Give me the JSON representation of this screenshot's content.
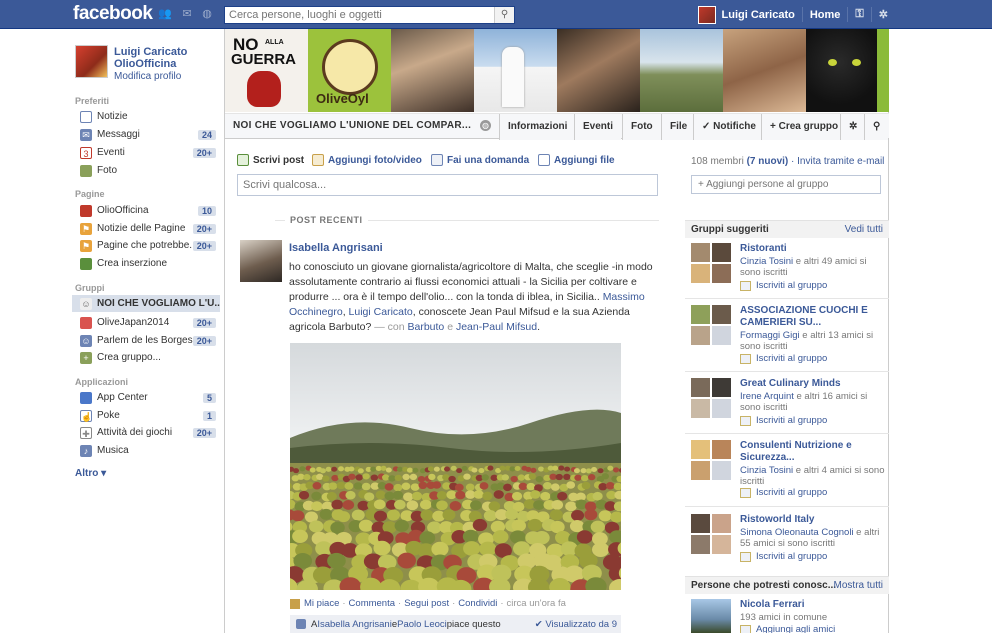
{
  "topbar": {
    "logo": "facebook",
    "search_placeholder": "Cerca persone, luoghi e oggetti",
    "user_name": "Luigi Caricato",
    "home_label": "Home"
  },
  "profile": {
    "name_line1": "Luigi Caricato",
    "name_line2": "OlioOfficina",
    "edit": "Modifica profilo"
  },
  "sidebar": {
    "favorites_heading": "Preferiti",
    "favorites": [
      {
        "label": "Notizie",
        "count": ""
      },
      {
        "label": "Messaggi",
        "count": "24"
      },
      {
        "label": "Eventi",
        "count": "20+"
      },
      {
        "label": "Foto",
        "count": ""
      }
    ],
    "pages_heading": "Pagine",
    "pages": [
      {
        "label": "OlioOfficina",
        "count": "10"
      },
      {
        "label": "Notizie delle Pagine",
        "count": "20+"
      },
      {
        "label": "Pagine che potrebbe...",
        "count": "20+"
      },
      {
        "label": "Crea inserzione",
        "count": ""
      }
    ],
    "groups_heading": "Gruppi",
    "groups": [
      {
        "label": "NOI CHE VOGLIAMO L'U...",
        "count": ""
      },
      {
        "label": "OliveJapan2014",
        "count": "20+"
      },
      {
        "label": "Parlem de les Borges...",
        "count": "20+"
      },
      {
        "label": "Crea gruppo...",
        "count": ""
      }
    ],
    "apps_heading": "Applicazioni",
    "apps": [
      {
        "label": "App Center",
        "count": "5"
      },
      {
        "label": "Poke",
        "count": "1"
      },
      {
        "label": "Attività dei giochi",
        "count": "20+"
      },
      {
        "label": "Musica",
        "count": ""
      }
    ],
    "more": "Altro ▾"
  },
  "cover": {
    "tile1_text_a": "NO",
    "tile1_text_b": "ALLA",
    "tile1_text_c": "GUERRA",
    "tile2_text": "OliveOyl"
  },
  "group": {
    "title": "NOI CHE VOGLIAMO L'UNIONE DEL COMPAR...",
    "tabs": [
      "Informazioni",
      "Eventi",
      "Foto",
      "File"
    ],
    "notifications": "✓ Notifiche",
    "create_group": "+ Crea gruppo"
  },
  "composer": {
    "options": [
      "Scrivi post",
      "Aggiungi foto/video",
      "Fai una domanda",
      "Aggiungi file"
    ],
    "placeholder": "Scrivi qualcosa..."
  },
  "recent_label": "POST RECENTI",
  "post": {
    "author": "Isabella Angrisani",
    "text_a": "ho conosciuto un giovane giornalista/agricoltore di Malta, che sceglie -in modo assolutamente contrario ai flussi economici attuali - la Sicilia per coltivare e produrre ... ora è il tempo dell'olio... con la tonda di iblea, in Sicilia.. ",
    "tag1": "Massimo Occhinegro",
    "tag2": "Luigi Caricato",
    "text_b": ", conoscete Jean Paul Mifsud e la sua Azienda agricola Barbuto?",
    "with_prefix": " — con ",
    "with1": "Barbuto",
    "with_and": " e ",
    "with2": "Jean-Paul Mifsud",
    "text_end": ".",
    "actions": [
      "Mi piace",
      "Commenta",
      "Segui post",
      "Condividi"
    ],
    "time": "circa un'ora fa",
    "likes_a": "A ",
    "likes_n1": "Isabella Angrisani",
    "likes_mid": " e ",
    "likes_n2": "Paolo Leoci",
    "likes_end": " piace questo",
    "seen": "✔ Visualizzato da 9"
  },
  "members": {
    "count": "108 membri",
    "new": "(7 nuovi)",
    "invite": "· Invita tramite e-mail",
    "add_placeholder": "+ Aggiungi persone al gruppo"
  },
  "suggested": {
    "heading": "Gruppi suggeriti",
    "see_all": "Vedi tutti",
    "join_label": "Iscriviti al gruppo",
    "items": [
      {
        "name": "Ristoranti",
        "friend": "Cinzia Tosini",
        "rest": " e altri 49 amici si sono iscritti"
      },
      {
        "name": "ASSOCIAZIONE CUOCHI E CAMERIERI SU...",
        "friend": "Formaggi Gigi",
        "rest": " e altri 13 amici si sono iscritti"
      },
      {
        "name": "Great Culinary Minds",
        "friend": "Irene Arquint",
        "rest": " e altri 16 amici si sono iscritti"
      },
      {
        "name": "Consulenti Nutrizione e Sicurezza...",
        "friend": "Cinzia Tosini",
        "rest": " e altri 4 amici si sono iscritti"
      },
      {
        "name": "Ristoworld Italy",
        "friend": "Simona Oleonauta Cognoli",
        "rest": " e altri 55 amici si sono iscritti"
      }
    ]
  },
  "people": {
    "heading": "Persone che potresti conosc...",
    "see_all": "Mostra tutti",
    "name": "Nicola Ferrari",
    "mutual": "193 amici in comune",
    "add": "Aggiungi agli amici"
  }
}
